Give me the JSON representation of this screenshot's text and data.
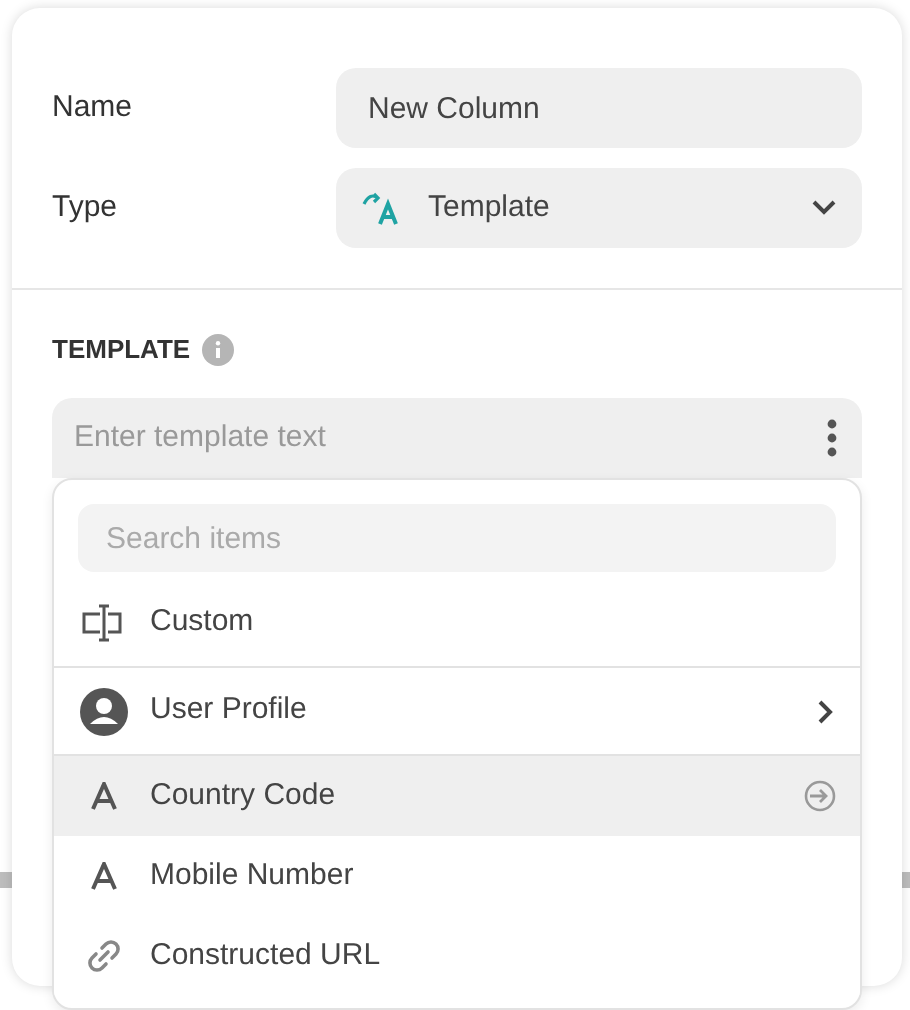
{
  "form": {
    "name": {
      "label": "Name",
      "value": "New Column"
    },
    "type": {
      "label": "Type",
      "value": "Template"
    }
  },
  "template": {
    "heading": "TEMPLATE",
    "placeholder": "Enter template text"
  },
  "dropdown": {
    "search_placeholder": "Search items",
    "items": [
      {
        "kind": "custom",
        "label": "Custom",
        "selected": false,
        "has_children": false
      },
      {
        "kind": "user",
        "label": "User Profile",
        "selected": false,
        "has_children": true
      },
      {
        "kind": "text",
        "label": "Country Code",
        "selected": true,
        "has_children": false
      },
      {
        "kind": "text",
        "label": "Mobile Number",
        "selected": false,
        "has_children": false
      },
      {
        "kind": "link",
        "label": "Constructed URL",
        "selected": false,
        "has_children": false
      }
    ]
  }
}
